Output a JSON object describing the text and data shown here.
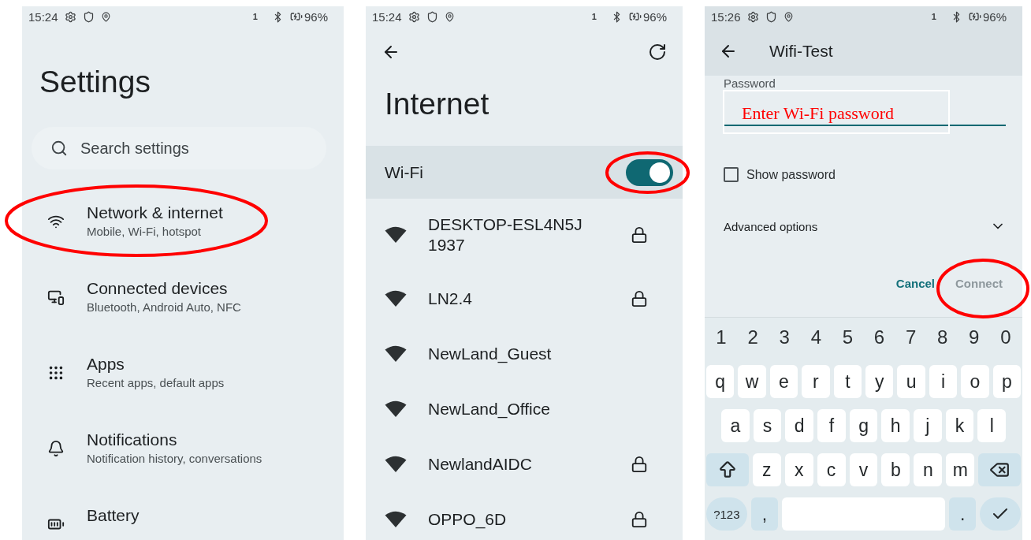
{
  "screens": [
    {
      "kind": "settings",
      "status": {
        "time": "15:24",
        "sim": "1",
        "battery": "96%"
      },
      "title": "Settings",
      "search": {
        "placeholder": "Search settings"
      },
      "items": [
        {
          "title": "Network & internet",
          "subtitle": "Mobile, Wi-Fi, hotspot"
        },
        {
          "title": "Connected devices",
          "subtitle": "Bluetooth, Android Auto, NFC"
        },
        {
          "title": "Apps",
          "subtitle": "Recent apps, default apps"
        },
        {
          "title": "Notifications",
          "subtitle": "Notification history, conversations"
        },
        {
          "title": "Battery"
        }
      ]
    },
    {
      "kind": "internet",
      "status": {
        "time": "15:24",
        "sim": "1",
        "battery": "96%"
      },
      "title": "Internet",
      "wifi": {
        "label": "Wi-Fi",
        "on": true
      },
      "networks": [
        {
          "name": "DESKTOP-ESL4N5J 1937",
          "locked": true
        },
        {
          "name": "LN2.4",
          "locked": true
        },
        {
          "name": "NewLand_Guest",
          "locked": false
        },
        {
          "name": "NewLand_Office",
          "locked": false
        },
        {
          "name": "NewlandAIDC",
          "locked": true
        },
        {
          "name": "OPPO_6D",
          "locked": true
        }
      ]
    },
    {
      "kind": "wifi_dialog",
      "status": {
        "time": "15:26",
        "sim": "1",
        "battery": "96%"
      },
      "title": "Wifi-Test",
      "field": {
        "label": "Password"
      },
      "show_password": {
        "label": "Show password",
        "checked": false
      },
      "advanced": {
        "label": "Advanced options",
        "expanded": false
      },
      "buttons": [
        {
          "label": "Cancel",
          "disabled": false
        },
        {
          "label": "Connect",
          "disabled": true
        }
      ],
      "keyboard": {
        "numbers": [
          "1",
          "2",
          "3",
          "4",
          "5",
          "6",
          "7",
          "8",
          "9",
          "0"
        ],
        "letter_rows": [
          [
            {
              "kind": "char",
              "label": "q"
            },
            {
              "kind": "char",
              "label": "w"
            },
            {
              "kind": "char",
              "label": "e"
            },
            {
              "kind": "char",
              "label": "r"
            },
            {
              "kind": "char",
              "label": "t"
            },
            {
              "kind": "char",
              "label": "y"
            },
            {
              "kind": "char",
              "label": "u"
            },
            {
              "kind": "char",
              "label": "i"
            },
            {
              "kind": "char",
              "label": "o"
            },
            {
              "kind": "char",
              "label": "p"
            }
          ],
          [
            {
              "kind": "char",
              "label": "a"
            },
            {
              "kind": "char",
              "label": "s"
            },
            {
              "kind": "char",
              "label": "d"
            },
            {
              "kind": "char",
              "label": "f"
            },
            {
              "kind": "char",
              "label": "g"
            },
            {
              "kind": "char",
              "label": "h"
            },
            {
              "kind": "char",
              "label": "j"
            },
            {
              "kind": "char",
              "label": "k"
            },
            {
              "kind": "char",
              "label": "l"
            }
          ],
          [
            {
              "kind": "shift"
            },
            {
              "kind": "char",
              "label": "z"
            },
            {
              "kind": "char",
              "label": "x"
            },
            {
              "kind": "char",
              "label": "c"
            },
            {
              "kind": "char",
              "label": "v"
            },
            {
              "kind": "char",
              "label": "b"
            },
            {
              "kind": "char",
              "label": "n"
            },
            {
              "kind": "char",
              "label": "m"
            },
            {
              "kind": "backspace"
            }
          ]
        ],
        "bottom_row": [
          {
            "kind": "symbols",
            "label": "?123"
          },
          {
            "kind": "punct",
            "label": ","
          },
          {
            "kind": "space"
          },
          {
            "kind": "punct",
            "label": "."
          },
          {
            "kind": "enter"
          }
        ]
      }
    }
  ],
  "note": {
    "text": "Enter Wi-Fi password"
  }
}
